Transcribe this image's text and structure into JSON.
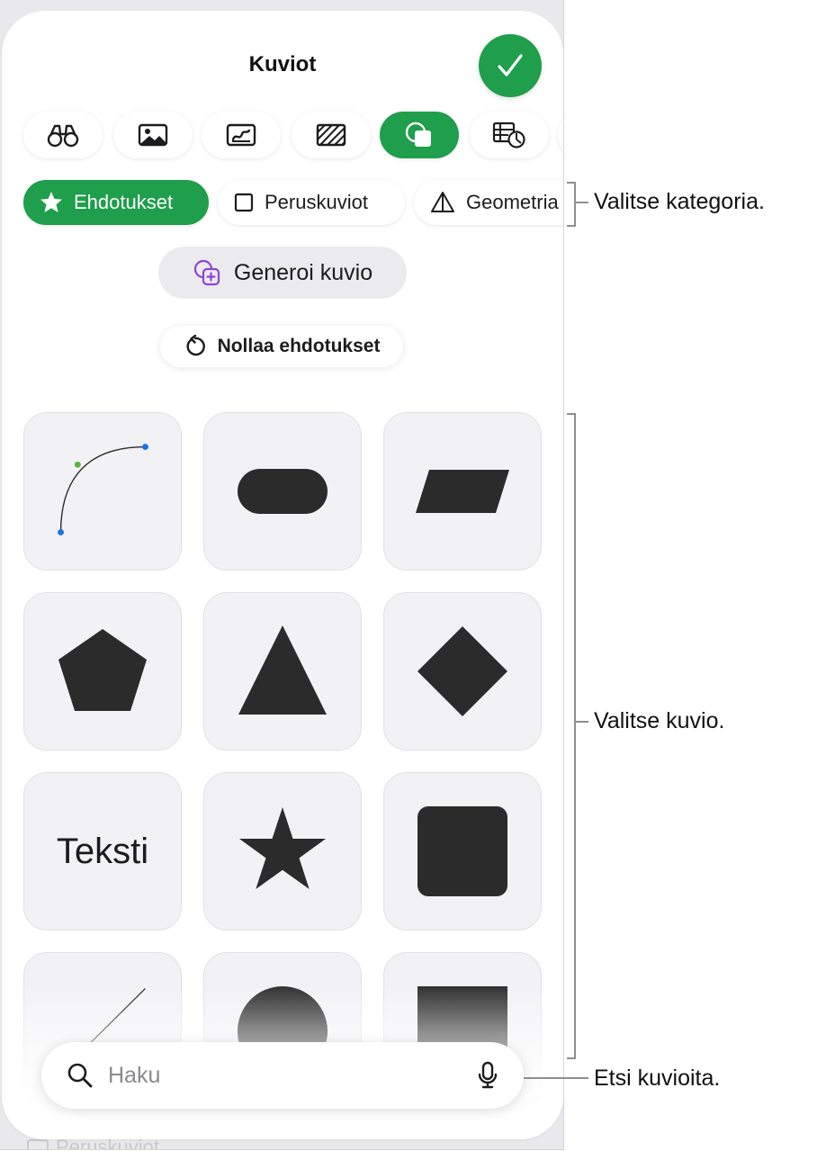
{
  "panel": {
    "title": "Kuviot",
    "done_icon": "checkmark-icon",
    "accent_color": "#1f9e4b",
    "background_section_label": "Peruskuviot"
  },
  "media_tabs": [
    {
      "icon": "binoculars-icon",
      "active": false
    },
    {
      "icon": "photo-icon",
      "active": false
    },
    {
      "icon": "drawing-icon",
      "active": false
    },
    {
      "icon": "pattern-icon",
      "active": false
    },
    {
      "icon": "shapes-icon",
      "active": true
    },
    {
      "icon": "table-chart-icon",
      "active": false
    }
  ],
  "categories": [
    {
      "label": "Ehdotukset",
      "icon": "star-icon",
      "active": true
    },
    {
      "label": "Peruskuviot",
      "icon": "square-icon",
      "active": false
    },
    {
      "label": "Geometria",
      "icon": "pyramid-icon",
      "active": false
    }
  ],
  "generate_button": {
    "label": "Generoi kuvio",
    "icon": "generate-shape-icon"
  },
  "reset_button": {
    "label": "Nollaa ehdotukset",
    "icon": "reset-icon"
  },
  "shapes": [
    {
      "name": "curve",
      "label": ""
    },
    {
      "name": "rounded-rectangle",
      "label": ""
    },
    {
      "name": "parallelogram",
      "label": ""
    },
    {
      "name": "pentagon",
      "label": ""
    },
    {
      "name": "triangle",
      "label": ""
    },
    {
      "name": "diamond",
      "label": ""
    },
    {
      "name": "text",
      "label": "Teksti"
    },
    {
      "name": "star",
      "label": ""
    },
    {
      "name": "rounded-square",
      "label": ""
    },
    {
      "name": "line",
      "label": ""
    },
    {
      "name": "circle",
      "label": ""
    },
    {
      "name": "square",
      "label": ""
    }
  ],
  "search": {
    "placeholder": "Haku",
    "value": "",
    "search_icon": "magnifier-icon",
    "mic_icon": "microphone-icon"
  },
  "callouts": {
    "category": "Valitse kategoria.",
    "shape": "Valitse kuvio.",
    "search": "Etsi kuvioita."
  }
}
